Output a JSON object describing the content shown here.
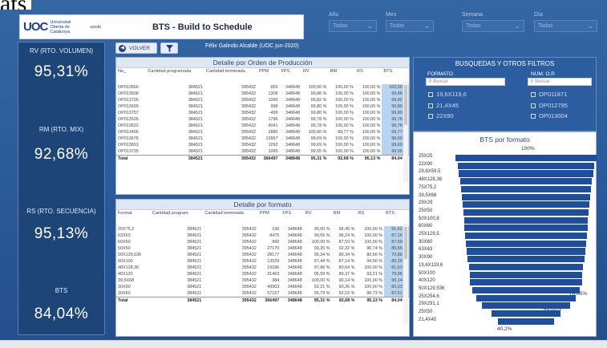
{
  "corner_fragment": "ats",
  "header": {
    "logo_mark": "UOC",
    "logo_text": "Universitat Oberta de Catalunya",
    "logo_sub": "uocdo",
    "title": "BTS - Build to Schedule"
  },
  "filters": [
    {
      "label": "Año",
      "value": "Todas"
    },
    {
      "label": "Mes",
      "value": "Todas"
    },
    {
      "label": "Semana",
      "value": "Todas"
    },
    {
      "label": "Día",
      "value": "Todas"
    }
  ],
  "kpis": [
    {
      "label": "RV (RTO. VOLUMEN)",
      "value": "95,31%"
    },
    {
      "label": "RM (RTO. MIX)",
      "value": "92,68%"
    },
    {
      "label": "RS (RTO. SECUENCIA)",
      "value": "95,13%"
    },
    {
      "label": "BTS",
      "value": "84,04%"
    }
  ],
  "buttons": {
    "back": "VOLVER",
    "back_icon": "back-arrow-icon",
    "filter_icon": "funnel-filter-icon"
  },
  "author": "Félix Galindo Alcalde (UOC jun-2020)",
  "orders_table": {
    "title": "Detalle por Orden de Producción",
    "columns": [
      "No_",
      "Cantidad programada",
      "Cantidad terminada",
      "PPM",
      "FPS",
      "RV",
      "RM",
      "RS",
      "BTS"
    ],
    "rows": [
      [
        "OP013666",
        "384521",
        "395432",
        "959",
        "348648",
        "100,00 %",
        "100,00 %",
        "100,00 %",
        "100,00 %"
      ],
      [
        "OP013508",
        "384521",
        "395432",
        "1308",
        "348648",
        "99,86 %",
        "100,00 %",
        "100,00 %",
        "99,86 %"
      ],
      [
        "OP013726",
        "384521",
        "395432",
        "1090",
        "348648",
        "99,82 %",
        "100,00 %",
        "100,00 %",
        "99,82 %"
      ],
      [
        "OP013699",
        "384521",
        "395432",
        "998",
        "348648",
        "99,80 %",
        "100,00 %",
        "100,00 %",
        "99,80 %"
      ],
      [
        "OP013757",
        "384521",
        "395432",
        "-499",
        "348648",
        "99,80 %",
        "100,00 %",
        "100,00 %",
        "99,80 %"
      ],
      [
        "OP013526",
        "384521",
        "395432",
        "1796",
        "348648",
        "99,78 %",
        "100,00 %",
        "100,00 %",
        "99,78 %"
      ],
      [
        "OP013622",
        "384521",
        "395432",
        "4041",
        "348648",
        "99,78 %",
        "100,00 %",
        "100,00 %",
        "99,78 %"
      ],
      [
        "OP013496",
        "384521",
        "395432",
        "2880",
        "348648",
        "100,00 %",
        "99,77 %",
        "100,00 %",
        "99,77 %"
      ],
      [
        "OP013676",
        "384521",
        "395432",
        "13957",
        "348648",
        "99,69 %",
        "100,00 %",
        "100,00 %",
        "99,69 %"
      ],
      [
        "OP013651",
        "384521",
        "395432",
        "1292",
        "348648",
        "99,69 %",
        "100,00 %",
        "100,00 %",
        "99,69 %"
      ],
      [
        "OP013735",
        "384521",
        "395432",
        "1095",
        "348648",
        "99,55 %",
        "100,00 %",
        "100,00 %",
        "99,55 %"
      ]
    ],
    "total": [
      "Total",
      "384521",
      "395432",
      "366497",
      "348648",
      "95,31 %",
      "92,68 %",
      "95,13 %",
      "84,04 %"
    ]
  },
  "format_table": {
    "title": "Detalle por formato",
    "columns": [
      "Format",
      "Cantidad program.",
      "Cantidad terminada",
      "PPM",
      "FPS",
      "RV",
      "RM",
      "RS",
      "BTS"
    ],
    "rows": [
      [
        "25X75,2",
        "384521",
        "395432",
        "190",
        "348648",
        "95,00 %",
        "96,45 %",
        "100,00 %",
        "91,62 %"
      ],
      [
        "63X63",
        "384521",
        "395432",
        "8475",
        "348648",
        "90,56 %",
        "96,24 %",
        "100,00 %",
        "87,16 %"
      ],
      [
        "60X60",
        "384521",
        "395432",
        "960",
        "348648",
        "100,00 %",
        "87,59 %",
        "100,00 %",
        "87,59 %"
      ],
      [
        "50X50",
        "384521",
        "395432",
        "27170",
        "348648",
        "90,35 %",
        "92,32 %",
        "90,74 %",
        "85,65 %"
      ],
      [
        "50X129,536",
        "384521",
        "395432",
        "28177",
        "348648",
        "95,34 %",
        "89,34 %",
        "80,66 %",
        "70,86 %"
      ],
      [
        "50X100",
        "384521",
        "395432",
        "13529",
        "348648",
        "97,44 %",
        "87,14 %",
        "94,56 %",
        "80,29 %"
      ],
      [
        "48X128,36",
        "384521",
        "395432",
        "19186",
        "348648",
        "97,86 %",
        "83,64 %",
        "100,00 %",
        "81,63 %"
      ],
      [
        "40X120",
        "384521",
        "395432",
        "21463",
        "348648",
        "95,99 %",
        "89,37 %",
        "93,21 %",
        "79,96 %"
      ],
      [
        "39,5X68",
        "384521",
        "395432",
        "384",
        "348648",
        "100,00 %",
        "90,14 %",
        "100,00 %",
        "90,14 %"
      ],
      [
        "30X90",
        "384521",
        "395432",
        "49903",
        "348648",
        "92,21 %",
        "90,26 %",
        "100,00 %",
        "83,23 %"
      ],
      [
        "30X60",
        "384521",
        "395432",
        "57157",
        "348648",
        "95,79 %",
        "92,53 %",
        "90,73 %",
        "87,51 %"
      ]
    ],
    "total": [
      "Total",
      "384521",
      "395432",
      "366497",
      "348648",
      "95,31 %",
      "92,68 %",
      "95,13 %",
      "84,04 %"
    ]
  },
  "search_panel": {
    "title": "BUSQUEDAS Y OTROS FILTROS",
    "formato_label": "FORMATO",
    "op_label": "NUM. O.P.",
    "search_placeholder": "Buscar",
    "formato_options": [
      "19,6X119,6",
      "21,4X45",
      "22X90"
    ],
    "op_options": [
      "OP011871",
      "OP012795",
      "OP013004"
    ]
  },
  "funnel": {
    "title": "BTS por formato",
    "top_label": "100%",
    "right_label_1": "70,05%",
    "right_label_2": "49,00%",
    "bottom_label": "40,2%",
    "categories": [
      "25X25",
      "22X90",
      "29,6X59,5",
      "48X128,36",
      "75X75,2",
      "39,5X68",
      "29X29",
      "25X50",
      "50X100,8",
      "60X60",
      "25X129,5",
      "30X60",
      "63X63",
      "30X90",
      "19,6X119,6",
      "50X100",
      "40X120",
      "50X129,536",
      "25X254,6",
      "29X291,1",
      "25X50",
      "21,4X45"
    ],
    "values": [
      100,
      97,
      95,
      93,
      92,
      91,
      90,
      89,
      88,
      87,
      86,
      85,
      84,
      83,
      81,
      80,
      79,
      76,
      70.05,
      62,
      49,
      40.2
    ]
  }
}
